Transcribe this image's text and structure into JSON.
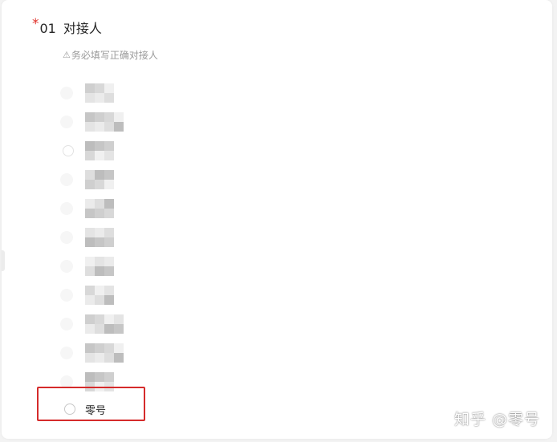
{
  "question": {
    "required_mark": "*",
    "number": "01",
    "title": "对接人",
    "hint_icon": "⚠",
    "hint": "务必填写正确对接人"
  },
  "options_last": {
    "label": "零号"
  },
  "watermark": "知乎 @零号",
  "colors": {
    "required": "#e0322b",
    "highlight": "#d52b2b",
    "text": "#262626",
    "hint": "#9a9a9a"
  }
}
